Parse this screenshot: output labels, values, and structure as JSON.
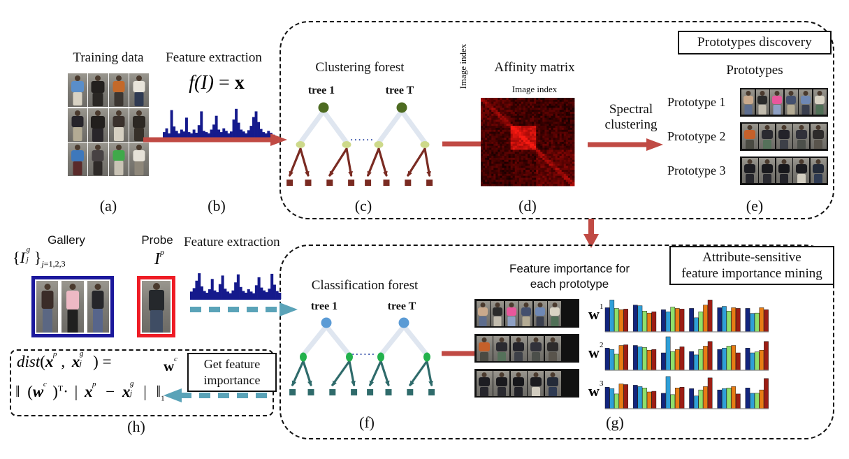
{
  "figure": {
    "panels": {
      "top_title": "Prototypes   discovery",
      "bottom_title_line1": "Attribute-sensitive",
      "bottom_title_line2": "feature importance mining"
    },
    "labels": {
      "training_data": "Training data",
      "feature_extraction": "Feature extraction",
      "feature_extraction2": "Feature extraction",
      "formula_fx": "f(I) = x",
      "clustering_forest": "Clustering forest",
      "classification_forest": "Classification forest",
      "tree1": "tree 1",
      "treeT": "tree T",
      "ellipsis": "......",
      "affinity_matrix": "Affinity matrix",
      "image_index_x": "Image index",
      "image_index_y": "Image index",
      "spectral_line1": "Spectral",
      "spectral_line2": "clustering",
      "prototypes": "Prototypes",
      "gallery": "Gallery",
      "probe": "Probe",
      "gallery_sym": "{I g j } j=1,2,3",
      "probe_sym": "I p",
      "feat_imp_line1": "Feature importance for",
      "feat_imp_line2": "each prototype",
      "get_feature_line1": "Get feature",
      "get_feature_line2": "importance",
      "wc": "w c"
    },
    "prototype_rows": [
      {
        "name": "Prototype  1",
        "count": 6
      },
      {
        "name": "Prototype  2",
        "count": 5
      },
      {
        "name": "Prototype  3",
        "count": 5
      }
    ],
    "weight_rows": [
      {
        "name": "w1",
        "base": "w",
        "exp": "1"
      },
      {
        "name": "w2",
        "base": "w",
        "exp": "2"
      },
      {
        "name": "w3",
        "base": "w",
        "exp": "3"
      }
    ],
    "subcaptions": {
      "a": "(a)",
      "b": "(b)",
      "c": "(c)",
      "d": "(d)",
      "e": "(e)",
      "f": "(f)",
      "g": "(g)",
      "h": "(h)"
    },
    "distance_formula": {
      "line1": "dist(x p , x g j ) =",
      "line2": "|| (w c )T · | x p − x g j |  ||1"
    },
    "colors": {
      "red_arrow": "#c04a44",
      "teal_arrow": "#5aa3b8",
      "navy_hist": "#151a8c",
      "clustering_root": "#4d6b21",
      "clustering_mid": "#cdd98a",
      "clustering_leaf": "#7a2b22",
      "classification_root": "#5b9bd5",
      "classification_mid": "#22b14c",
      "classification_leaf": "#2f6b6b",
      "gallery_border": "#1b189c",
      "probe_border": "#ee1c25",
      "affinity_bright": "#e01010",
      "panel_dash": "#111111"
    }
  },
  "chart_data": {
    "type": "bar",
    "title": "Feature importance for each prototype",
    "series_colors": [
      "#12257e",
      "#2f9fd8",
      "#8fe06a",
      "#e87c14",
      "#9c1d14"
    ],
    "legend_position": "none",
    "grid": false,
    "ylim": [
      0,
      1
    ],
    "groups": 6,
    "bars_per_group": 5,
    "rows": [
      {
        "label": "w1",
        "values": [
          [
            0.72,
            0.95,
            0.7,
            0.66,
            0.68
          ],
          [
            0.8,
            0.78,
            0.62,
            0.56,
            0.6
          ],
          [
            0.66,
            0.6,
            0.74,
            0.7,
            0.68
          ],
          [
            0.7,
            0.42,
            0.6,
            0.8,
            0.95
          ],
          [
            0.72,
            0.76,
            0.62,
            0.72,
            0.7
          ],
          [
            0.7,
            0.55,
            0.56,
            0.72,
            0.66
          ]
        ]
      },
      {
        "label": "w2",
        "values": [
          [
            0.66,
            0.62,
            0.48,
            0.74,
            0.76
          ],
          [
            0.74,
            0.7,
            0.68,
            0.6,
            0.62
          ],
          [
            0.52,
            1.0,
            0.56,
            0.62,
            0.7
          ],
          [
            0.56,
            0.46,
            0.62,
            0.72,
            0.86
          ],
          [
            0.62,
            0.66,
            0.72,
            0.74,
            0.52
          ],
          [
            0.66,
            0.52,
            0.55,
            0.6,
            0.86
          ]
        ]
      },
      {
        "label": "w3",
        "values": [
          [
            0.64,
            0.6,
            0.44,
            0.74,
            0.72
          ],
          [
            0.7,
            0.66,
            0.62,
            0.5,
            0.52
          ],
          [
            0.46,
            0.96,
            0.42,
            0.62,
            0.64
          ],
          [
            0.6,
            0.38,
            0.56,
            0.66,
            0.92
          ],
          [
            0.56,
            0.6,
            0.62,
            0.66,
            0.44
          ],
          [
            0.62,
            0.46,
            0.46,
            0.56,
            0.9
          ]
        ]
      }
    ]
  },
  "histograms": {
    "top": [
      0.22,
      0.34,
      0.18,
      0.92,
      0.4,
      0.26,
      0.18,
      0.3,
      0.24,
      0.68,
      0.22,
      0.18,
      0.3,
      0.2,
      0.44,
      0.88,
      0.26,
      0.22,
      0.18,
      0.3,
      0.46,
      0.74,
      0.3,
      0.22,
      0.34,
      0.26,
      0.18,
      0.24,
      0.62,
      0.96,
      0.52,
      0.3,
      0.24,
      0.18,
      0.28,
      0.42,
      0.7,
      0.88,
      0.54,
      0.32,
      0.22,
      0.18,
      0.26,
      0.2,
      0.14
    ],
    "bottom": [
      0.26,
      0.38,
      0.64,
      0.9,
      0.44,
      0.28,
      0.22,
      0.34,
      0.7,
      0.3,
      0.24,
      0.52,
      0.82,
      0.36,
      0.26,
      0.2,
      0.3,
      0.58,
      0.86,
      0.42,
      0.28,
      0.22,
      0.34,
      0.26,
      0.2,
      0.48,
      0.76,
      0.4,
      0.3,
      0.24,
      0.36,
      0.88,
      0.5,
      0.28,
      0.22
    ]
  }
}
